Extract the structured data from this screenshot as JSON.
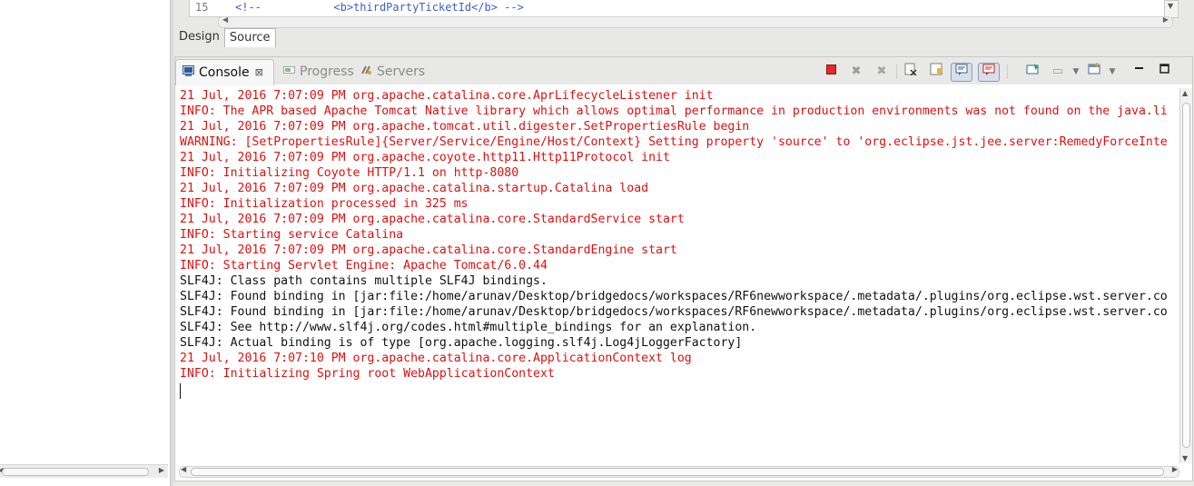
{
  "editor": {
    "line_number": "15",
    "code_line": "<!--           <b>thirdPartyTicketId</b> -->",
    "tabs": [
      "Design",
      "Source"
    ],
    "active_tab": "Source"
  },
  "console_view": {
    "tabs": [
      {
        "label": "Console",
        "icon": "console-icon",
        "active": true
      },
      {
        "label": "Progress",
        "icon": "progress-icon",
        "active": false
      },
      {
        "label": "Servers",
        "icon": "servers-icon",
        "active": false
      }
    ],
    "toolbar_icons": [
      "terminate-icon",
      "remove-launch-icon",
      "remove-all-terminated-icon",
      "clear-console-icon",
      "scroll-lock-icon",
      "show-console-on-stdout-icon",
      "show-console-on-stderr-icon",
      "pin-console-icon",
      "display-selected-console-icon",
      "open-console-icon",
      "minimize-icon",
      "maximize-icon"
    ],
    "colors": {
      "stderr": "#e01010",
      "stdout": "#111111"
    }
  },
  "console_lines": [
    {
      "text": "21 Jul, 2016 7:07:09 PM org.apache.catalina.core.AprLifecycleListener init",
      "stream": "err"
    },
    {
      "text": "INFO: The APR based Apache Tomcat Native library which allows optimal performance in production environments was not found on the java.li",
      "stream": "err"
    },
    {
      "text": "21 Jul, 2016 7:07:09 PM org.apache.tomcat.util.digester.SetPropertiesRule begin",
      "stream": "err"
    },
    {
      "text": "WARNING: [SetPropertiesRule]{Server/Service/Engine/Host/Context} Setting property 'source' to 'org.eclipse.jst.jee.server:RemedyForceInte",
      "stream": "err"
    },
    {
      "text": "21 Jul, 2016 7:07:09 PM org.apache.coyote.http11.Http11Protocol init",
      "stream": "err"
    },
    {
      "text": "INFO: Initializing Coyote HTTP/1.1 on http-8080",
      "stream": "err"
    },
    {
      "text": "21 Jul, 2016 7:07:09 PM org.apache.catalina.startup.Catalina load",
      "stream": "err"
    },
    {
      "text": "INFO: Initialization processed in 325 ms",
      "stream": "err"
    },
    {
      "text": "21 Jul, 2016 7:07:09 PM org.apache.catalina.core.StandardService start",
      "stream": "err"
    },
    {
      "text": "INFO: Starting service Catalina",
      "stream": "err"
    },
    {
      "text": "21 Jul, 2016 7:07:09 PM org.apache.catalina.core.StandardEngine start",
      "stream": "err"
    },
    {
      "text": "INFO: Starting Servlet Engine: Apache Tomcat/6.0.44",
      "stream": "err"
    },
    {
      "text": "SLF4J: Class path contains multiple SLF4J bindings.",
      "stream": "out"
    },
    {
      "text": "SLF4J: Found binding in [jar:file:/home/arunav/Desktop/bridgedocs/workspaces/RF6newworkspace/.metadata/.plugins/org.eclipse.wst.server.co",
      "stream": "out"
    },
    {
      "text": "SLF4J: Found binding in [jar:file:/home/arunav/Desktop/bridgedocs/workspaces/RF6newworkspace/.metadata/.plugins/org.eclipse.wst.server.co",
      "stream": "out"
    },
    {
      "text": "SLF4J: See http://www.slf4j.org/codes.html#multiple_bindings for an explanation.",
      "stream": "out"
    },
    {
      "text": "SLF4J: Actual binding is of type [org.apache.logging.slf4j.Log4jLoggerFactory]",
      "stream": "out"
    },
    {
      "text": "21 Jul, 2016 7:07:10 PM org.apache.catalina.core.ApplicationContext log",
      "stream": "err"
    },
    {
      "text": "INFO: Initializing Spring root WebApplicationContext",
      "stream": "err"
    }
  ]
}
